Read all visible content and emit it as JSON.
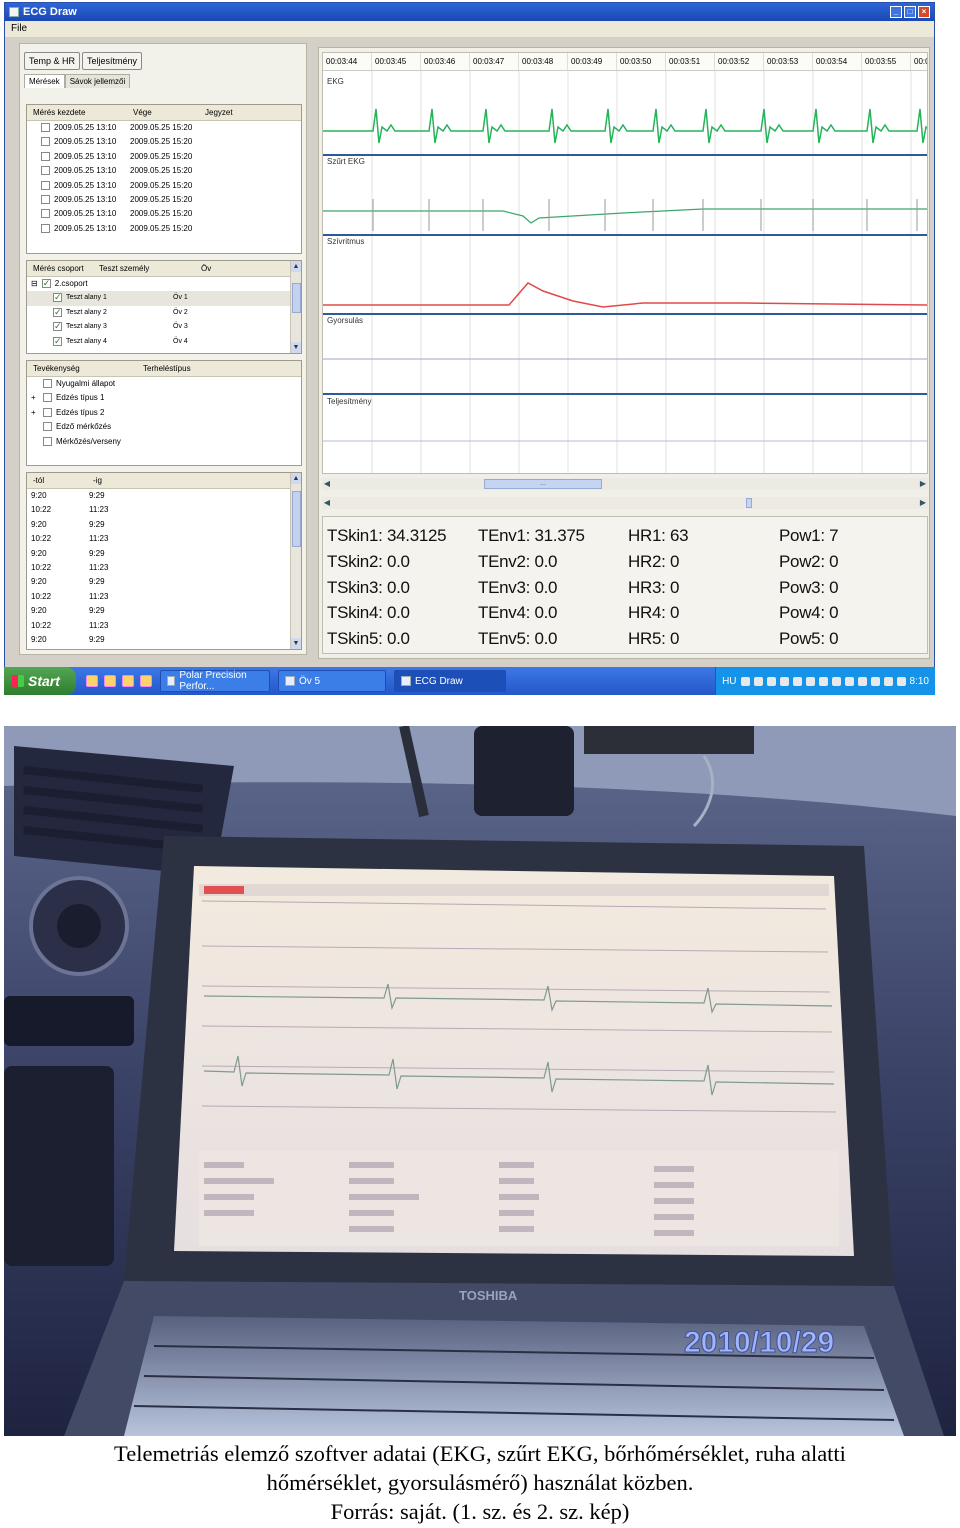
{
  "window": {
    "title": "ECG Draw",
    "menu": [
      "File"
    ]
  },
  "left": {
    "buttons": [
      "Temp & HR",
      "Teljesítmény"
    ],
    "tabs": [
      "Mérések",
      "Sávok jellemzői"
    ],
    "measurements": {
      "headers": [
        "Mérés kezdete",
        "Vége",
        "Jegyzet"
      ],
      "rows": [
        [
          "2009.05.25 13:10",
          "2009.05.25 15:20"
        ],
        [
          "2009.05.25 13:10",
          "2009.05.25 15:20"
        ],
        [
          "2009.05.25 13:10",
          "2009.05.25 15:20"
        ],
        [
          "2009.05.25 13:10",
          "2009.05.25 15:20"
        ],
        [
          "2009.05.25 13:10",
          "2009.05.25 15:20"
        ],
        [
          "2009.05.25 13:10",
          "2009.05.25 15:20"
        ],
        [
          "2009.05.25 13:10",
          "2009.05.25 15:20"
        ],
        [
          "2009.05.25 13:10",
          "2009.05.25 15:20"
        ]
      ]
    },
    "groups": {
      "headers": [
        "Mérés csoport",
        "Teszt személy",
        "Öv"
      ],
      "group_label": "2.csoport",
      "rows": [
        [
          "Teszt alany 1",
          "Öv 1"
        ],
        [
          "Teszt alany 2",
          "Öv 2"
        ],
        [
          "Teszt alany 3",
          "Öv 3"
        ],
        [
          "Teszt alany 4",
          "Öv 4"
        ]
      ]
    },
    "activities": {
      "headers": [
        "Tevékenység",
        "Terheléstípus"
      ],
      "rows": [
        {
          "label": "Nyugalmi állapot",
          "expand": ""
        },
        {
          "label": "Edzés típus 1",
          "expand": "+"
        },
        {
          "label": "Edzés típus 2",
          "expand": "+"
        },
        {
          "label": "Edző mérkőzés",
          "expand": ""
        },
        {
          "label": "Mérkőzés/verseny",
          "expand": ""
        }
      ]
    },
    "times": {
      "headers": [
        "-tól",
        "-ig"
      ],
      "rows": [
        [
          "9:20",
          "9:29"
        ],
        [
          "10:22",
          "11:23"
        ],
        [
          "9:20",
          "9:29"
        ],
        [
          "10:22",
          "11:23"
        ],
        [
          "9:20",
          "9:29"
        ],
        [
          "10:22",
          "11:23"
        ],
        [
          "9:20",
          "9:29"
        ],
        [
          "10:22",
          "11:23"
        ],
        [
          "9:20",
          "9:29"
        ],
        [
          "10:22",
          "11:23"
        ],
        [
          "9:20",
          "9:29"
        ]
      ]
    }
  },
  "timeline": [
    "00:03:44",
    "00:03:45",
    "00:03:46",
    "00:03:47",
    "00:03:48",
    "00:03:49",
    "00:03:50",
    "00:03:51",
    "00:03:52",
    "00:03:53",
    "00:03:54",
    "00:03:55",
    "00:0"
  ],
  "tracks": [
    "EKG",
    "Szűrt EKG",
    "Szívritmus",
    "Gyorsulás",
    "Teljesítmény"
  ],
  "scroll_mid": "...",
  "readouts": {
    "tskin": [
      "TSkin1: 34.3125",
      "TSkin2: 0.0",
      "TSkin3: 0.0",
      "TSkin4: 0.0",
      "TSkin5: 0.0"
    ],
    "tenv": [
      "TEnv1: 31.375",
      "TEnv2: 0.0",
      "TEnv3: 0.0",
      "TEnv4: 0.0",
      "TEnv5: 0.0"
    ],
    "hr": [
      "HR1: 63",
      "HR2: 0",
      "HR3: 0",
      "HR4: 0",
      "HR5: 0"
    ],
    "pow": [
      "Pow1: 7",
      "Pow2: 0",
      "Pow3: 0",
      "Pow4: 0",
      "Pow5: 0"
    ]
  },
  "taskbar": {
    "start": "Start",
    "tasks": [
      "Polar Precision Perfor...",
      "Öv 5",
      "ECG Draw"
    ],
    "lang": "HU",
    "clock": "8:10"
  },
  "photo": {
    "date_stamp": "2010/10/29",
    "laptop_brand": "TOSHIBA"
  },
  "caption": {
    "line1": "Telemetriás elemző szoftver adatai (EKG, szűrt EKG, bőrhőmérséklet, ruha alatti",
    "line2": "hőmérséklet, gyorsulásmérő) használat közben.",
    "line3": "Forrás: saját. (1. sz. és 2. sz. kép)"
  },
  "colors": {
    "ekg": "#27b35a",
    "filtered_ekg": "#3aa86a",
    "heart_rate": "#e04a4a",
    "separator": "#2f5a9a",
    "date_stamp": "#9fb6ff"
  }
}
